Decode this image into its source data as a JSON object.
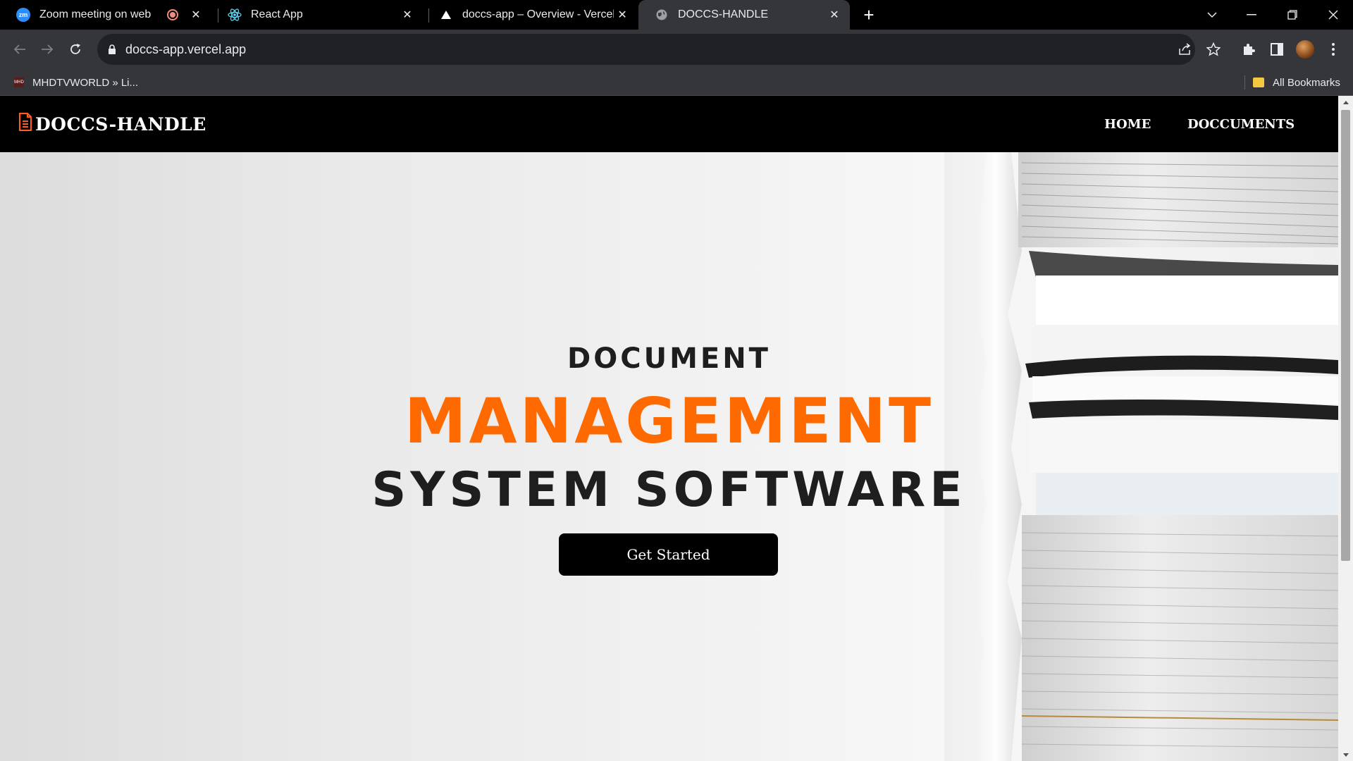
{
  "browser": {
    "tabs": [
      {
        "title": "Zoom meeting on web",
        "favicon": "zoom-icon",
        "recording": true,
        "active": false
      },
      {
        "title": "React App",
        "favicon": "react-icon",
        "active": false
      },
      {
        "title": "doccs-app – Overview - Vercel",
        "favicon": "vercel-icon",
        "active": false
      },
      {
        "title": "DOCCS-HANDLE",
        "favicon": "globe-icon",
        "active": true
      }
    ],
    "url": "doccs-app.vercel.app",
    "bookmarks": [
      {
        "label": "MHDTVWORLD » Li...",
        "favicon_text": "MHD"
      }
    ],
    "all_bookmarks_label": "All Bookmarks"
  },
  "site": {
    "brand": "DOCCS-HANDLE",
    "nav": {
      "home": "HOME",
      "documents": "DOCCUMENTS"
    },
    "hero": {
      "line1": "DOCUMENT",
      "line2": "MANAGEMENT",
      "line3": "SYSTEM SOFTWARE",
      "cta": "Get Started"
    }
  },
  "colors": {
    "accent": "#ff6a00",
    "nav_bg": "#000000",
    "tab_active_bg": "#35363a",
    "brand_icon": "#ff5a1f"
  }
}
